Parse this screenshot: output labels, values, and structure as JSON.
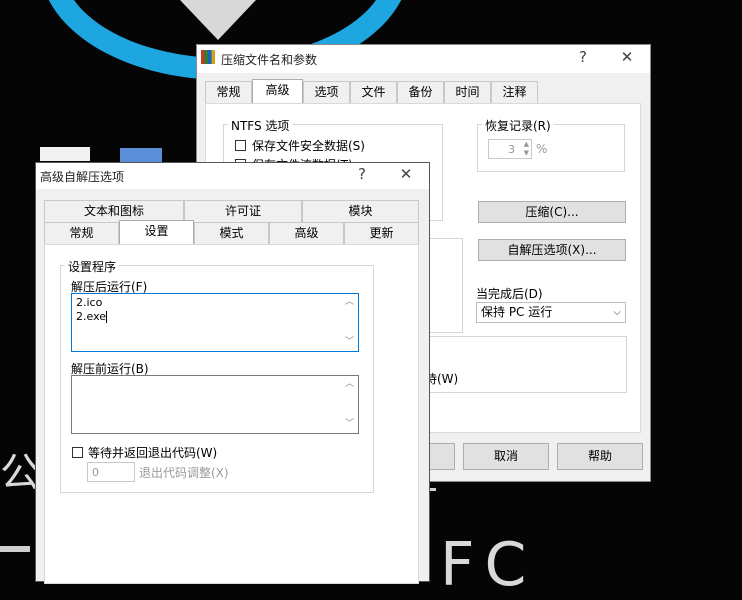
{
  "main_dialog": {
    "title": "压缩文件名和参数",
    "help_glyph": "?",
    "close_glyph": "✕",
    "tabs": [
      "常规",
      "高级",
      "选项",
      "文件",
      "备份",
      "时间",
      "注释"
    ],
    "active_tab": "高级",
    "ntfs_group_title": "NTFS 选项",
    "ntfs_options": [
      "保存文件安全数据(S)",
      "保存文件流数据(T)"
    ],
    "recovery_title": "恢复记录(R)",
    "recovery_value": "3",
    "recovery_unit": "%",
    "compress_button": "压缩(C)...",
    "sfx_button": "自解压选项(X)...",
    "after_complete_label": "当完成后(D)",
    "after_complete_value": "保持 PC 运行",
    "wait_fragment": "待(W)",
    "cancel_button": "取消",
    "help_button": "帮助"
  },
  "sfx_dialog": {
    "title": "高级自解压选项",
    "help_glyph": "?",
    "close_glyph": "✕",
    "tabs_row1": [
      "文本和图标",
      "许可证",
      "模块"
    ],
    "tabs_row2": [
      "常规",
      "设置",
      "模式",
      "高级",
      "更新"
    ],
    "active_tab": "设置",
    "group_title": "设置程序",
    "run_after_label": "解压后运行(F)",
    "run_after_lines": [
      "2.ico",
      "2.exe"
    ],
    "run_before_label": "解压前运行(B)",
    "wait_checkbox_label": "等待并返回退出代码(W)",
    "exit_code_value": "0",
    "exit_code_label": "退出代码调整(X)"
  },
  "background": {
    "text_left": "公",
    "text_bottom": "FC"
  }
}
